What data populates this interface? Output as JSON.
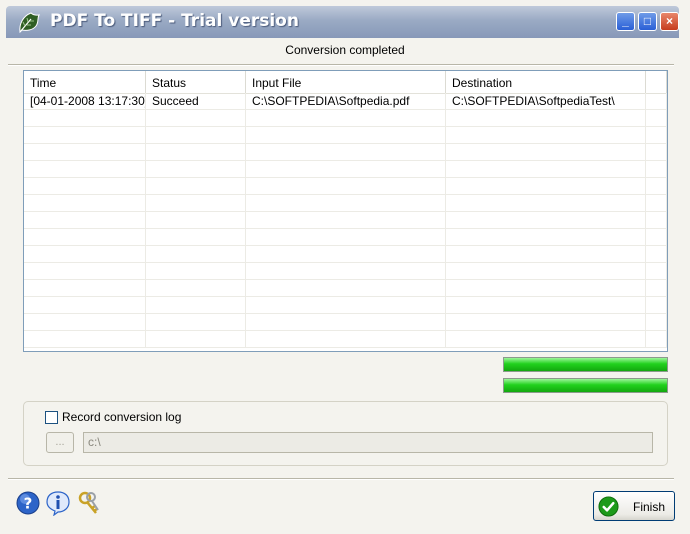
{
  "window": {
    "title": "PDF To TIFF - Trial version"
  },
  "titlebar_buttons": {
    "minimize": "_",
    "maximize": "□",
    "close": "×"
  },
  "status_message": "Conversion completed",
  "table": {
    "columns": [
      "Time",
      "Status",
      "Input File",
      "Destination"
    ],
    "rows": [
      [
        "[04-01-2008 13:17:30]",
        "Succeed",
        "C:\\SOFTPEDIA\\Softpedia.pdf",
        "C:\\SOFTPEDIA\\SoftpediaTest\\"
      ]
    ]
  },
  "progress": {
    "overall": 1.0,
    "current": 1.0
  },
  "log": {
    "checkbox_label": "Record conversion log",
    "checked": false,
    "browse_label": "...",
    "path_value": "c:\\"
  },
  "footer": {
    "icons": [
      "help-icon",
      "info-icon",
      "keys-icon"
    ],
    "finish_label": "Finish"
  },
  "colors": {
    "title_gradient_top": "#bfc9da",
    "title_gradient_bottom": "#8798b8",
    "progress_green": "#22d11e",
    "close_red": "#c63c1e"
  }
}
